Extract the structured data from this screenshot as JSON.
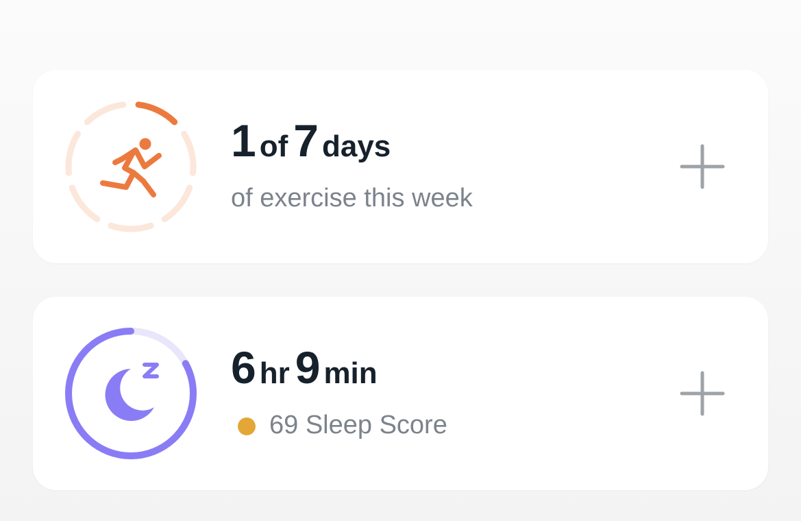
{
  "exercise": {
    "value": "1",
    "of_label": "of",
    "goal": "7",
    "unit": "days",
    "subtitle": "of exercise this week",
    "progress": "1/7",
    "icon": "running-person-icon"
  },
  "sleep": {
    "hours": "6",
    "hours_unit": "hr",
    "minutes": "9",
    "minutes_unit": "min",
    "score_text": "69 Sleep Score",
    "progress_fraction": 0.83,
    "icon": "moon-zzz-icon"
  },
  "colors": {
    "exercise_accent": "#EC7A3F",
    "exercise_track": "#FCE7DB",
    "sleep_accent": "#8A7CF5",
    "sleep_track": "#E9E6FC",
    "score_dot": "#E3A737",
    "add_icon": "#9EA3A8"
  }
}
